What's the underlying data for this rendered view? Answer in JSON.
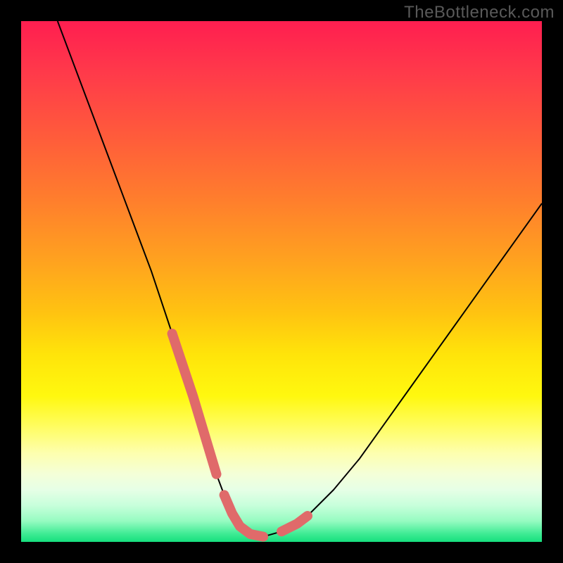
{
  "watermark": "TheBottleneck.com",
  "chart_data": {
    "type": "line",
    "title": "",
    "xlabel": "",
    "ylabel": "",
    "x_range": [
      0,
      100
    ],
    "y_range": [
      0,
      100
    ],
    "series": [
      {
        "name": "bottleneck-curve",
        "stroke": "#000000",
        "stroke_width": 2,
        "x": [
          7,
          10,
          13,
          16,
          19,
          22,
          25,
          27,
          29,
          31,
          33,
          34.5,
          36,
          37.5,
          39,
          40.5,
          42,
          44,
          46.5,
          50,
          55,
          60,
          65,
          70,
          75,
          80,
          85,
          90,
          95,
          100
        ],
        "y": [
          100,
          92,
          84,
          76,
          68,
          60,
          52,
          46,
          40,
          34,
          28,
          23,
          18,
          13,
          9,
          5.5,
          3,
          1.5,
          1,
          2,
          5,
          10,
          16,
          23,
          30,
          37,
          44,
          51,
          58,
          65
        ]
      },
      {
        "name": "highlight-left-descent",
        "stroke": "#e06a6a",
        "stroke_width": 14,
        "linecap": "round",
        "x": [
          29,
          31,
          33,
          34.5,
          36,
          37.5
        ],
        "y": [
          40,
          34,
          28,
          23,
          18,
          13
        ]
      },
      {
        "name": "highlight-valley",
        "stroke": "#e06a6a",
        "stroke_width": 14,
        "linecap": "round",
        "x": [
          39,
          40.5,
          42,
          44,
          46.5
        ],
        "y": [
          9,
          5.5,
          3,
          1.5,
          1
        ]
      },
      {
        "name": "highlight-right-ascent",
        "stroke": "#e06a6a",
        "stroke_width": 14,
        "linecap": "round",
        "x": [
          50,
          53,
          55
        ],
        "y": [
          2,
          3.5,
          5
        ]
      }
    ],
    "background_gradient": {
      "direction": "top-to-bottom",
      "stops": [
        {
          "pos": 0.0,
          "color": "#ff1e50"
        },
        {
          "pos": 0.5,
          "color": "#ffb015"
        },
        {
          "pos": 0.72,
          "color": "#ffee0d"
        },
        {
          "pos": 0.88,
          "color": "#f6ffd0"
        },
        {
          "pos": 1.0,
          "color": "#16e07e"
        }
      ]
    }
  }
}
